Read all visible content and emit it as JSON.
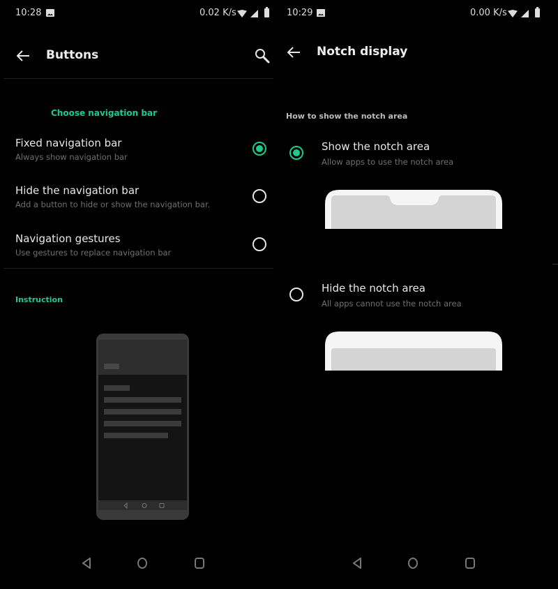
{
  "left_screen": {
    "status_bar": {
      "time": "10:28",
      "net_speed": "0.02 K/s",
      "icons": [
        "image-icon",
        "wifi-icon",
        "signal-icon",
        "battery-icon"
      ]
    },
    "app_bar": {
      "title": "Buttons",
      "back_icon": "arrow-left-icon",
      "action_icon": "search-icon"
    },
    "section_title": "Choose navigation bar",
    "options": [
      {
        "label": "Fixed navigation bar",
        "description": "Always show navigation bar",
        "selected": true
      },
      {
        "label": "Hide the navigation bar",
        "description": "Add a button to hide or show the navigation bar.",
        "selected": false
      },
      {
        "label": "Navigation gestures",
        "description": "Use gestures to replace navigation bar",
        "selected": false
      }
    ],
    "instruction_title": "Instruction",
    "illustration": "phone-navigation-bar-illustration"
  },
  "right_screen": {
    "status_bar": {
      "time": "10:29",
      "net_speed": "0.00 K/s",
      "icons": [
        "image-icon",
        "wifi-icon",
        "signal-icon",
        "battery-icon"
      ]
    },
    "app_bar": {
      "title": "Notch display",
      "back_icon": "arrow-left-icon"
    },
    "section_title": "How to show the notch area",
    "options": [
      {
        "label": "Show the notch area",
        "description": "Allow apps to use the notch area",
        "selected": true,
        "illustration": "notch-shown-illustration"
      },
      {
        "label": "Hide the notch area",
        "description": "All apps cannot use the notch area",
        "selected": false,
        "illustration": "notch-hidden-illustration"
      }
    ]
  },
  "system_nav": {
    "buttons": [
      "back-icon",
      "home-icon",
      "recents-icon"
    ]
  },
  "colors": {
    "accent": "#1ec98f",
    "background": "#000000",
    "primary_text": "#e8e8e8",
    "secondary_text": "#6f6f6f"
  }
}
